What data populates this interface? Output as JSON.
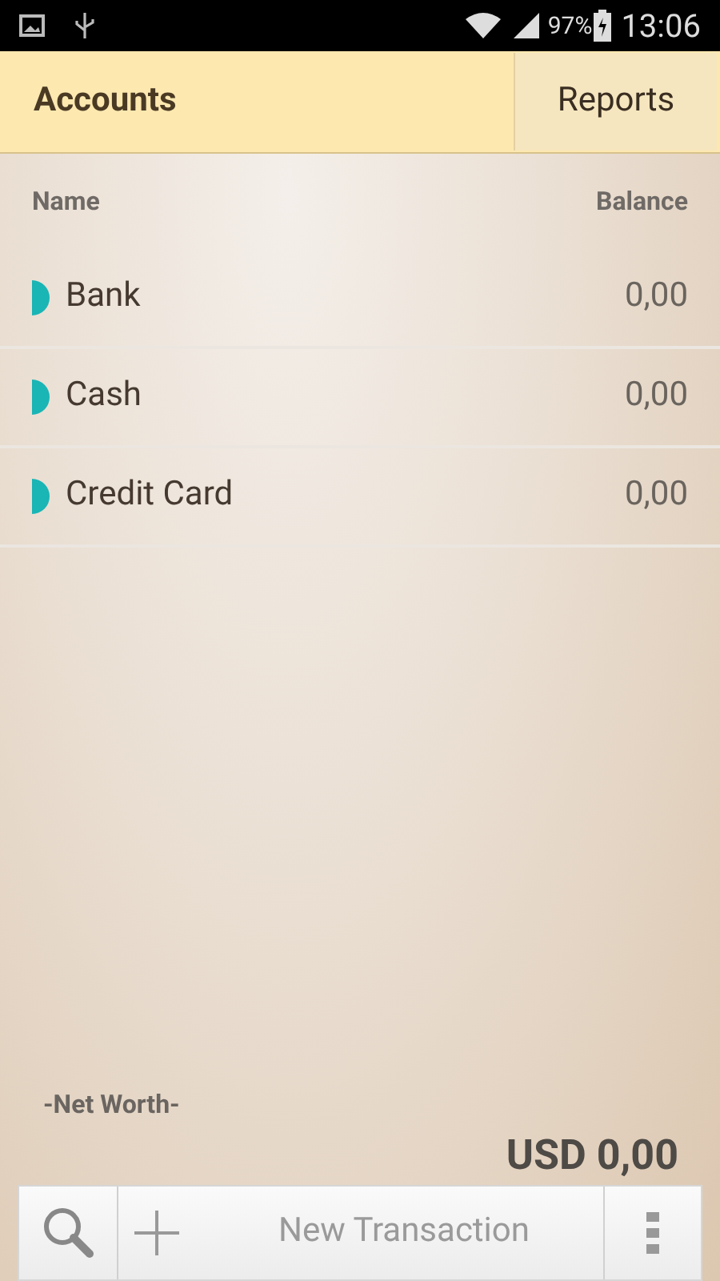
{
  "status_bar": {
    "battery": "97%",
    "time": "13:06"
  },
  "tabs": [
    {
      "label": "Accounts",
      "selected": true
    },
    {
      "label": "Reports",
      "selected": false
    }
  ],
  "table": {
    "columns": [
      "Name",
      "Balance"
    ],
    "rows": [
      {
        "name": "Bank",
        "balance": "0,00",
        "color": "#1ab5b5"
      },
      {
        "name": "Cash",
        "balance": "0,00",
        "color": "#1ab5b5"
      },
      {
        "name": "Credit Card",
        "balance": "0,00",
        "color": "#1ab5b5"
      }
    ]
  },
  "net_worth": {
    "label": "-Net Worth-",
    "value": "USD 0,00"
  },
  "bottom_bar": {
    "new_transaction": "New Transaction"
  }
}
